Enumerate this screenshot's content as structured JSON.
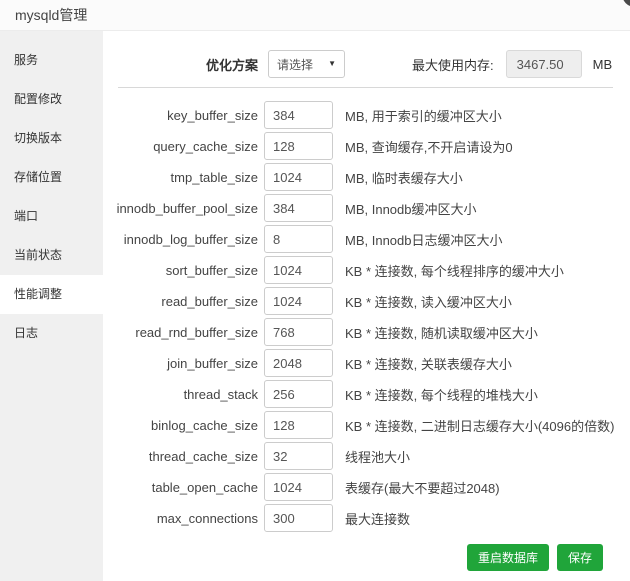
{
  "window": {
    "title": "mysqld管理"
  },
  "sidebar": {
    "items": [
      {
        "key": "service",
        "label": "服务",
        "active": false
      },
      {
        "key": "config-edit",
        "label": "配置修改",
        "active": false
      },
      {
        "key": "switch-version",
        "label": "切换版本",
        "active": false
      },
      {
        "key": "storage-location",
        "label": "存储位置",
        "active": false
      },
      {
        "key": "port",
        "label": "端口",
        "active": false
      },
      {
        "key": "current-status",
        "label": "当前状态",
        "active": false
      },
      {
        "key": "performance-tuning",
        "label": "性能调整",
        "active": true
      },
      {
        "key": "logs",
        "label": "日志",
        "active": false
      }
    ]
  },
  "toolbar": {
    "plan_label": "优化方案",
    "plan_selected": "请选择",
    "caret_icon": "▼",
    "memory_label": "最大使用内存:",
    "memory_value": "3467.50",
    "memory_unit": "MB"
  },
  "form": {
    "rows": [
      {
        "name": "key_buffer_size",
        "value": "384",
        "hint": "MB, 用于索引的缓冲区大小"
      },
      {
        "name": "query_cache_size",
        "value": "128",
        "hint": "MB, 查询缓存,不开启请设为0"
      },
      {
        "name": "tmp_table_size",
        "value": "1024",
        "hint": "MB, 临时表缓存大小"
      },
      {
        "name": "innodb_buffer_pool_size",
        "value": "384",
        "hint": "MB, Innodb缓冲区大小"
      },
      {
        "name": "innodb_log_buffer_size",
        "value": "8",
        "hint": "MB, Innodb日志缓冲区大小"
      },
      {
        "name": "sort_buffer_size",
        "value": "1024",
        "hint": "KB * 连接数, 每个线程排序的缓冲大小"
      },
      {
        "name": "read_buffer_size",
        "value": "1024",
        "hint": "KB * 连接数, 读入缓冲区大小"
      },
      {
        "name": "read_rnd_buffer_size",
        "value": "768",
        "hint": "KB * 连接数, 随机读取缓冲区大小"
      },
      {
        "name": "join_buffer_size",
        "value": "2048",
        "hint": "KB * 连接数, 关联表缓存大小"
      },
      {
        "name": "thread_stack",
        "value": "256",
        "hint": "KB * 连接数, 每个线程的堆栈大小"
      },
      {
        "name": "binlog_cache_size",
        "value": "128",
        "hint": "KB * 连接数, 二进制日志缓存大小(4096的倍数)"
      },
      {
        "name": "thread_cache_size",
        "value": "32",
        "hint": "线程池大小"
      },
      {
        "name": "table_open_cache",
        "value": "1024",
        "hint": "表缓存(最大不要超过2048)"
      },
      {
        "name": "max_connections",
        "value": "300",
        "hint": "最大连接数"
      }
    ]
  },
  "footer": {
    "restart_label": "重启数据库",
    "save_label": "保存"
  },
  "colors": {
    "accent_green": "#20a53a",
    "sidebar_bg": "#f0f0f0",
    "disabled_input_bg": "#eeeeee"
  }
}
